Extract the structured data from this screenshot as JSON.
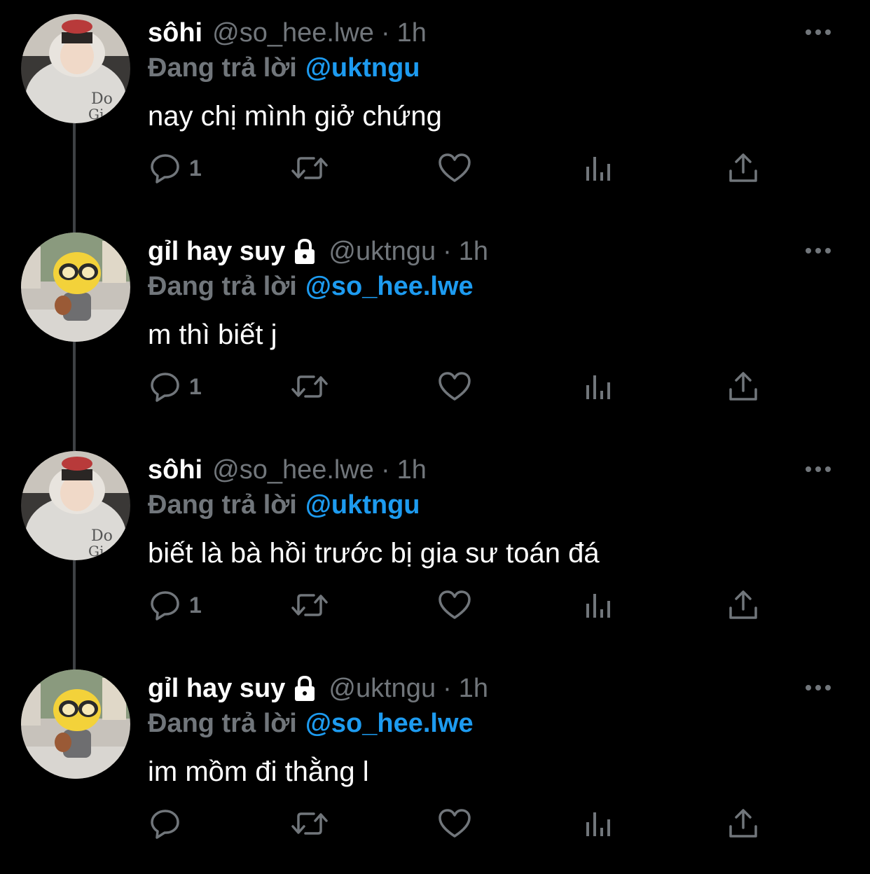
{
  "tweets": [
    {
      "display_name": "sôhi",
      "handle": "@so_hee.lwe",
      "separator": "·",
      "time": "1h",
      "reply_prefix": "Đang trả lời",
      "reply_to": "@uktngu",
      "text": "nay chị mình giở chứng",
      "reply_count": "1",
      "avatar": "person-in-white-hoodie",
      "locked": false
    },
    {
      "display_name": "gỉl hay suy",
      "handle": "@uktngu",
      "separator": "·",
      "time": "1h",
      "reply_prefix": "Đang trả lời",
      "reply_to": "@so_hee.lwe",
      "text": "m thì biết j",
      "reply_count": "1",
      "avatar": "yellow-minion-toy",
      "locked": true
    },
    {
      "display_name": "sôhi",
      "handle": "@so_hee.lwe",
      "separator": "·",
      "time": "1h",
      "reply_prefix": "Đang trả lời",
      "reply_to": "@uktngu",
      "text": "biết là bà hồi trước bị gia sư toán đá",
      "reply_count": "1",
      "avatar": "person-in-white-hoodie",
      "locked": false
    },
    {
      "display_name": "gỉl hay suy",
      "handle": "@uktngu",
      "separator": "·",
      "time": "1h",
      "reply_prefix": "Đang trả lời",
      "reply_to": "@so_hee.lwe",
      "text": "im mồm đi thằng l",
      "reply_count": "",
      "avatar": "yellow-minion-toy",
      "locked": true
    }
  ],
  "icons": {
    "reply": "reply-icon",
    "retweet": "retweet-icon",
    "like": "like-icon",
    "views": "views-icon",
    "share": "share-icon",
    "more": "more-icon",
    "lock": "lock-icon"
  },
  "colors": {
    "background": "#000000",
    "name": "#ffffff",
    "secondary": "#71767b",
    "mention": "#1d9bf0",
    "thread_line": "#3e4144"
  }
}
